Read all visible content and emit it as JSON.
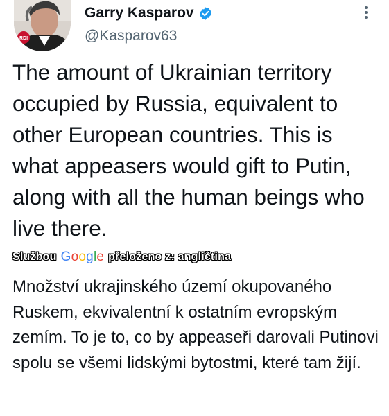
{
  "tweet": {
    "author": {
      "display_name": "Garry Kasparov",
      "handle": "@Kasparov63",
      "verified_icon": "verified-badge-icon",
      "verified_color": "#1d9bf0",
      "avatar_badge": "RDI"
    },
    "more_icon": "more-options-icon",
    "text": "The amount of Ukrainian territory occupied by Russia, equivalent to other European countries. This is what appeasers would gift to Putin, along with all the human beings who live there.",
    "translation": {
      "prefix": "Službou",
      "provider_letters": [
        "G",
        "o",
        "o",
        "g",
        "l",
        "e"
      ],
      "suffix": "přeloženo z: angličtina",
      "text": "Množství ukrajinského území okupovaného Ruskem, ekvivalentní k ostatním evropským zemím. To je to, co by appeaseři darovali Putinovi spolu se všemi lidskými bytostmi, které tam žijí."
    }
  }
}
